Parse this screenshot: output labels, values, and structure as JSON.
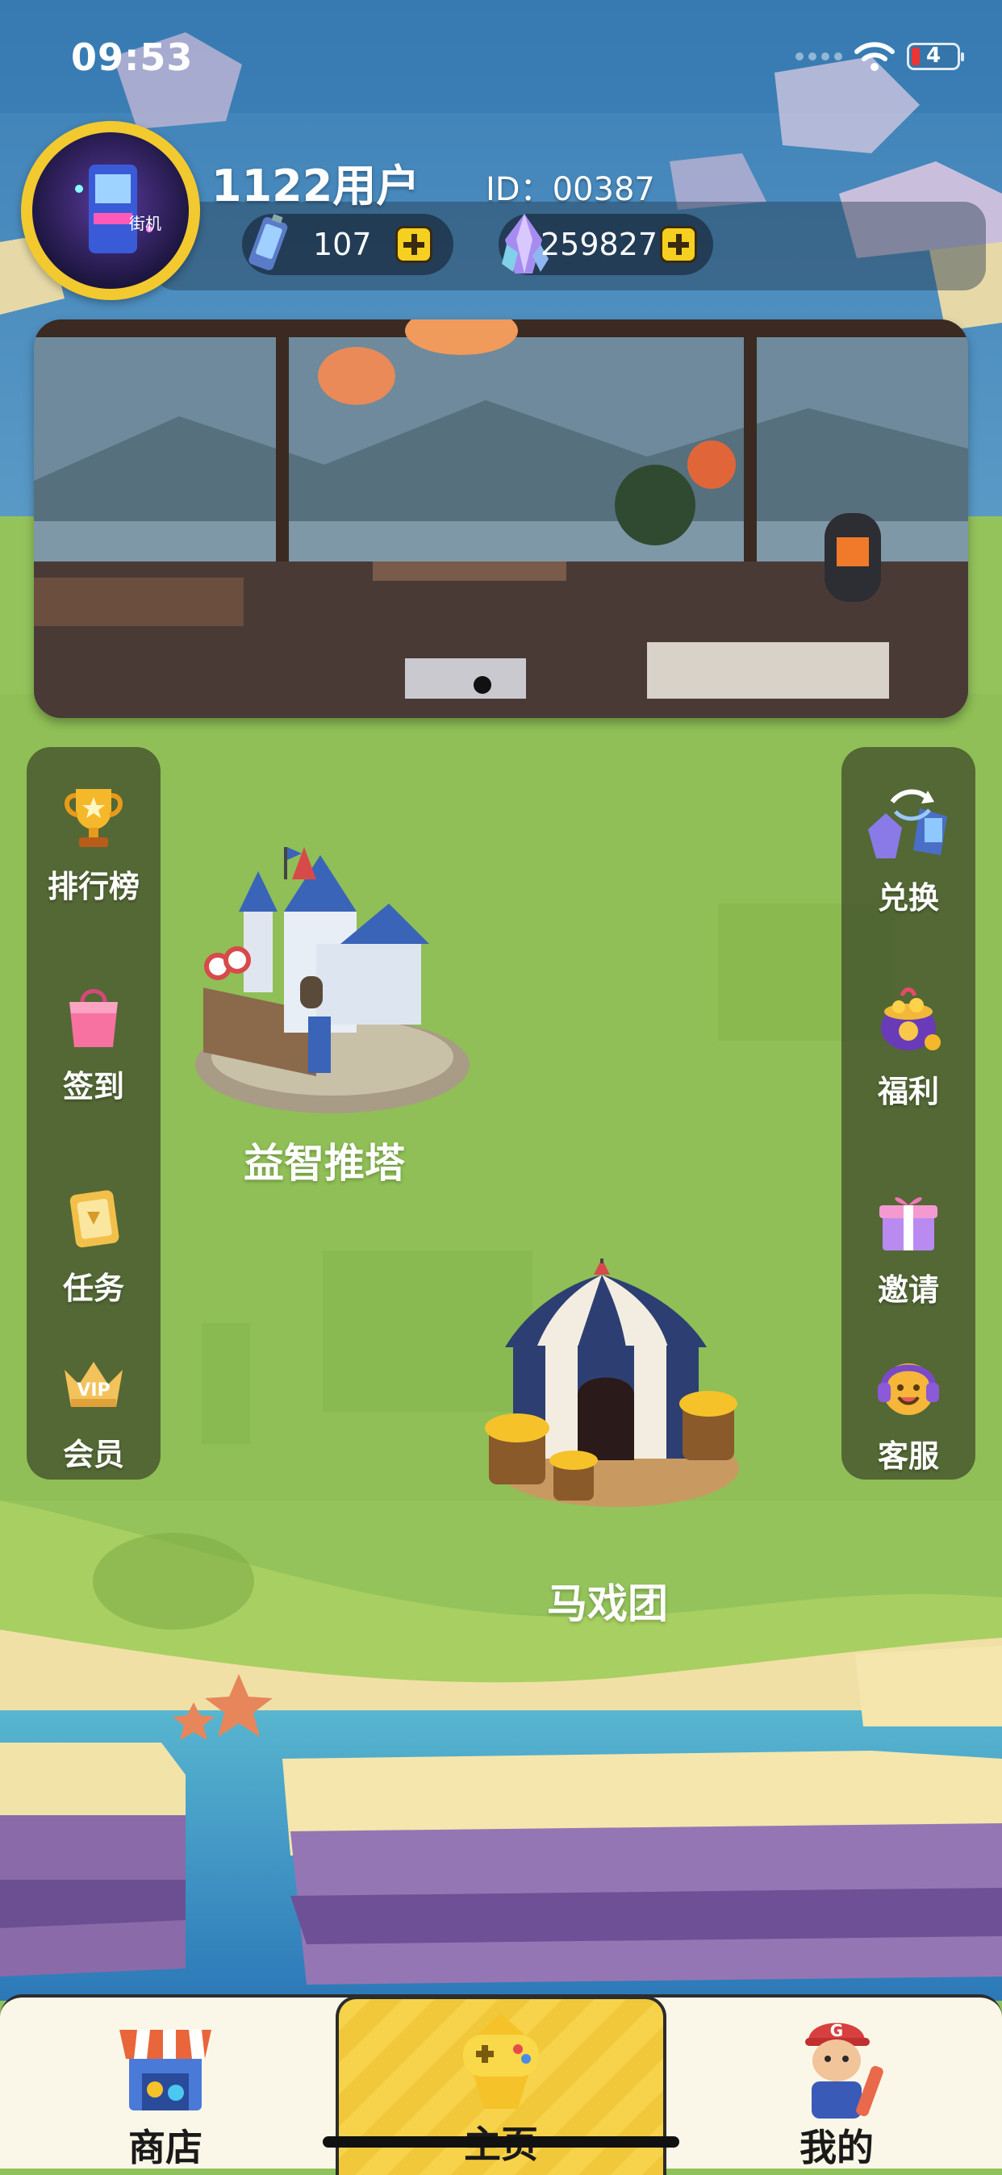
{
  "status_bar": {
    "time": "09:53",
    "battery": "4"
  },
  "profile": {
    "username": "1122用户",
    "user_id": "ID：00387",
    "energy_count": "107",
    "gem_count": "259827"
  },
  "banner": {
    "page_count": 1,
    "active_page": 1
  },
  "left_menu": [
    {
      "label": "排行榜",
      "icon": "trophy-icon"
    },
    {
      "label": "签到",
      "icon": "shopping-bag-icon"
    },
    {
      "label": "任务",
      "icon": "task-book-icon"
    },
    {
      "label": "会员",
      "icon": "vip-crown-icon"
    }
  ],
  "right_menu": [
    {
      "label": "兑换",
      "icon": "exchange-icon"
    },
    {
      "label": "福利",
      "icon": "gift-pot-icon"
    },
    {
      "label": "邀请",
      "icon": "gift-box-icon"
    },
    {
      "label": "客服",
      "icon": "headset-icon"
    }
  ],
  "games": [
    {
      "label": "益智推塔",
      "icon": "castle-icon"
    },
    {
      "label": "马戏团",
      "icon": "circus-tent-icon"
    }
  ],
  "bottom_nav": [
    {
      "label": "商店",
      "icon": "shop-icon"
    },
    {
      "label": "主页",
      "icon": "gamepad-icon",
      "active": true
    },
    {
      "label": "我的",
      "icon": "character-icon"
    }
  ],
  "colors": {
    "accent": "#f5d020",
    "nav_active": "#f6d34a",
    "panel": "#3c4628"
  }
}
